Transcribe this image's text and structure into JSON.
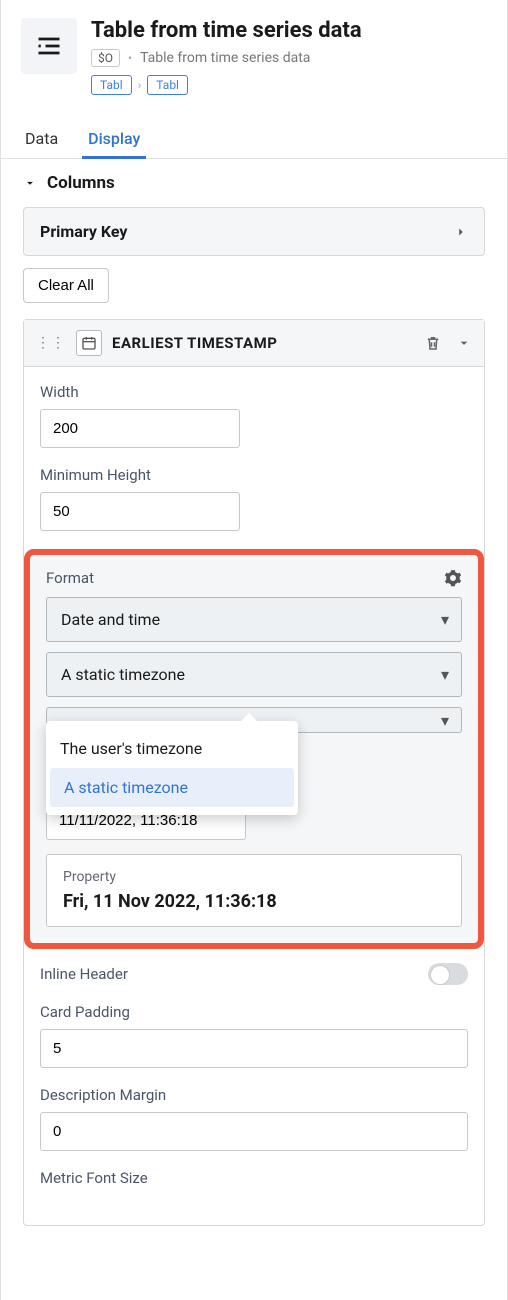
{
  "header": {
    "title": "Table from time series data",
    "so": "$O",
    "subtitle": "Table from time series data",
    "breadcrumb": [
      "Tabl",
      "Tabl"
    ]
  },
  "tabs": [
    {
      "label": "Data",
      "active": false
    },
    {
      "label": "Display",
      "active": true
    }
  ],
  "section": {
    "title": "Columns"
  },
  "primary_key": {
    "label": "Primary Key"
  },
  "clear_all": "Clear All",
  "column": {
    "title": "EARLIEST TIMESTAMP",
    "width_label": "Width",
    "width_value": "200",
    "min_height_label": "Minimum Height",
    "min_height_value": "50",
    "format": {
      "label": "Format",
      "type": "Date and time",
      "tz_mode": "A static timezone",
      "options": [
        "The user's timezone",
        "A static timezone"
      ],
      "date_input": "11/11/2022, 11:36:18",
      "property_label": "Property",
      "property_value": "Fri, 11 Nov 2022, 11:36:18"
    },
    "inline_header": "Inline Header",
    "card_padding_label": "Card Padding",
    "card_padding_value": "5",
    "desc_margin_label": "Description Margin",
    "desc_margin_value": "0",
    "metric_font_label": "Metric Font Size"
  }
}
